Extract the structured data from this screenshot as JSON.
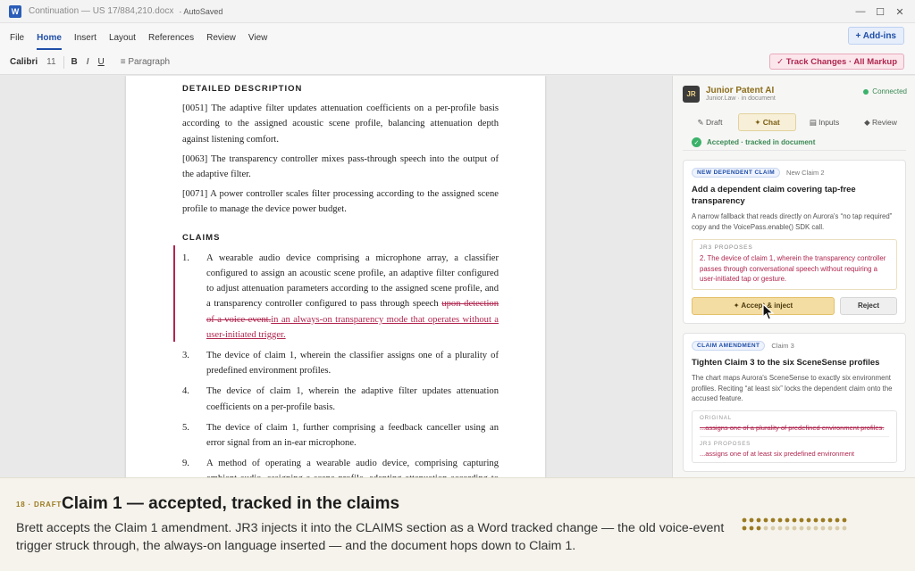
{
  "window": {
    "app_icon": "W",
    "title": "Continuation — US 17/884,210.docx",
    "autosaved": "· AutoSaved"
  },
  "menu": {
    "items": [
      "File",
      "Home",
      "Insert",
      "Layout",
      "References",
      "Review",
      "View"
    ],
    "active": "Home",
    "addins": "+ Add-ins"
  },
  "toolbar": {
    "font": "Calibri",
    "size": "11",
    "bold": "B",
    "italic": "I",
    "underline": "U",
    "paragraph": "≡ Paragraph",
    "track_changes": "✓ Track Changes · All Markup"
  },
  "document": {
    "detailed_heading": "DETAILED DESCRIPTION",
    "paragraphs": [
      "[0051] The adaptive filter updates attenuation coefficients on a per-profile basis according to the assigned acoustic scene profile, balancing attenuation depth against listening comfort.",
      "[0063] The transparency controller mixes pass-through speech into the output of the adaptive filter.",
      "[0071] A power controller scales filter processing according to the assigned scene profile to manage the device power budget."
    ],
    "claims_heading": "CLAIMS",
    "claim1": {
      "num": "1.",
      "text": "A wearable audio device comprising a microphone array, a classifier configured to assign an acoustic scene profile, an adaptive filter configured to adjust attenuation parameters according to the assigned scene profile, and a transparency controller configured to pass through speech ",
      "deleted": "upon detection of a voice event.",
      "inserted": "in an always-on transparency mode that operates without a user-initiated trigger."
    },
    "claims": [
      {
        "num": "3.",
        "text": "The device of claim 1, wherein the classifier assigns one of a plurality of predefined environment profiles."
      },
      {
        "num": "4.",
        "text": "The device of claim 1, wherein the adaptive filter updates attenuation coefficients on a per-profile basis."
      },
      {
        "num": "5.",
        "text": "The device of claim 1, further comprising a feedback canceller using an error signal from an in-ear microphone."
      },
      {
        "num": "9.",
        "text": "A method of operating a wearable audio device, comprising capturing ambient audio, assigning a scene profile, adapting attenuation according to the profile, and passing through speech upon detection of a voice event."
      }
    ]
  },
  "panel": {
    "avatar": "JR",
    "name": "Junior Patent AI",
    "subtitle": "Junior.Law · in document",
    "status": "Connected",
    "tabs": [
      {
        "label": "✎ Draft"
      },
      {
        "label": "✦ Chat"
      },
      {
        "label": "▤ Inputs"
      },
      {
        "label": "◆ Review"
      }
    ],
    "accepted_text": "Accepted · tracked in document",
    "card1": {
      "badge": "NEW DEPENDENT CLAIM",
      "badge_sub": "New Claim 2",
      "title": "Add a dependent claim covering tap-free transparency",
      "desc": "A narrow fallback that reads directly on Aurora's “no tap required” copy and the VoicePass.enable() SDK call.",
      "proposal_label": "JR3 PROPOSES",
      "proposal_text": "2. The device of claim 1, wherein the transparency controller passes through conversational speech without requiring a user-initiated tap or gesture.",
      "accept": "✦ Accept & inject",
      "reject": "Reject"
    },
    "card2": {
      "badge": "CLAIM AMENDMENT",
      "badge_sub": "Claim 3",
      "title": "Tighten Claim 3 to the six SceneSense profiles",
      "desc": "The chart maps Aurora's SceneSense to exactly six environment profiles. Reciting “at least six” locks the dependent claim onto the accused feature.",
      "original_label": "ORIGINAL",
      "original_text": "...assigns one of a plurality of predefined environment profiles.",
      "proposal_label": "JR3 PROPOSES",
      "proposal_text": "...assigns one of at least six predefined environment"
    }
  },
  "caption": {
    "step": "18 · DRAFT",
    "title": "Claim 1 — accepted, tracked in the claims",
    "body": "Brett accepts the Claim 1 amendment. JR3 injects it into the CLAIMS section as a Word tracked change — the old voice-event trigger struck through, the always-on language inserted — and the document hops down to Claim 1.",
    "progress_total": 30,
    "progress_current": 18
  }
}
